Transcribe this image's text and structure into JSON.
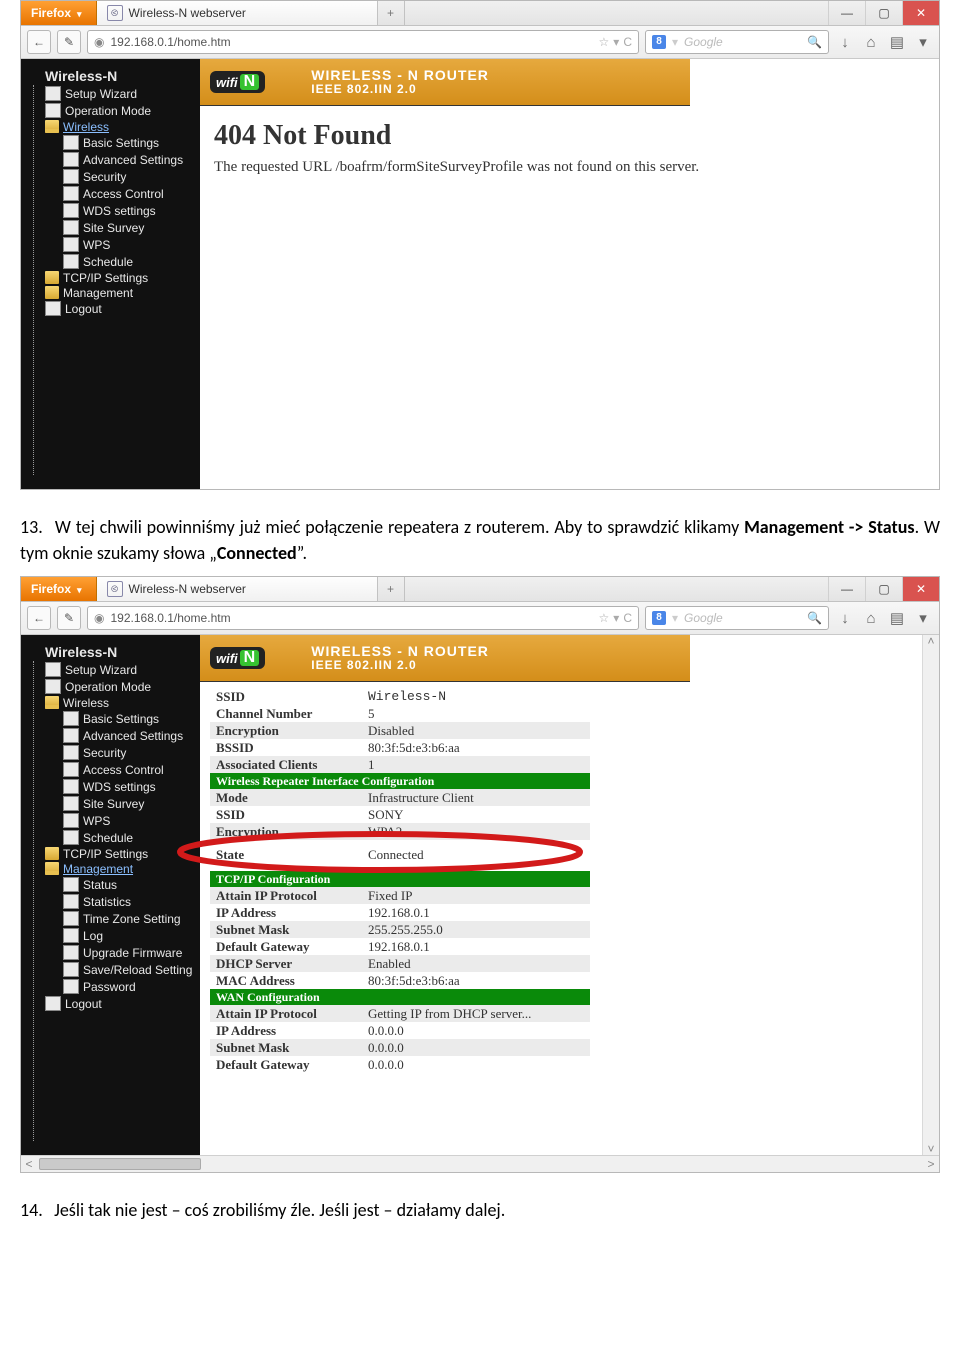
{
  "doc": {
    "para13_num": "13.",
    "para13_a": "W tej chwili powinniśmy już mieć połączenie repeatera z routerem. Aby to sprawdzić klikamy ",
    "para13_b1": "Management -> Status",
    "para13_c": ". W tym oknie szukamy słowa „",
    "para13_b2": "Connected",
    "para13_d": "”.",
    "para14_num": "14.",
    "para14_text": "Jeśli tak nie jest – coś zrobiliśmy źle. Jeśli jest – działamy dalej."
  },
  "browser": {
    "firefox_label": "Firefox",
    "tab_title": "Wireless-N webserver",
    "new_tab": "+",
    "win_min": "—",
    "win_max": "▢",
    "win_close": "✕",
    "back": "←",
    "tool_wand": "✎",
    "url_globe": "◉",
    "url": "192.168.0.1/home.htm",
    "star": "☆",
    "dd": "▾",
    "reload": "C",
    "search_g": "8",
    "search_sep": "▾",
    "search_ph": "Google",
    "search_go": "🔍",
    "dl": "↓",
    "home": "⌂",
    "menu": "▤",
    "menu_dd": "▾",
    "scroll_up": "˄",
    "scroll_down": "˅",
    "scroll_left": "<",
    "scroll_right": ">"
  },
  "router_banner": {
    "wifi_text": "wifi",
    "n_badge": "N",
    "line1": "WIRELESS - N ROUTER",
    "line2": "IEEE 802.IIN 2.0"
  },
  "sidebar1": {
    "head": "Wireless-N",
    "items": [
      {
        "lvl": 1,
        "ic": "doc",
        "label": "Setup Wizard"
      },
      {
        "lvl": 1,
        "ic": "doc",
        "label": "Operation Mode"
      },
      {
        "lvl": 1,
        "ic": "folder-open",
        "label": "Wireless",
        "hl": true
      },
      {
        "lvl": 2,
        "ic": "doc",
        "label": "Basic Settings"
      },
      {
        "lvl": 2,
        "ic": "doc",
        "label": "Advanced Settings"
      },
      {
        "lvl": 2,
        "ic": "doc",
        "label": "Security"
      },
      {
        "lvl": 2,
        "ic": "doc",
        "label": "Access Control"
      },
      {
        "lvl": 2,
        "ic": "doc",
        "label": "WDS settings"
      },
      {
        "lvl": 2,
        "ic": "doc",
        "label": "Site Survey"
      },
      {
        "lvl": 2,
        "ic": "doc",
        "label": "WPS"
      },
      {
        "lvl": 2,
        "ic": "doc",
        "label": "Schedule"
      },
      {
        "lvl": 1,
        "ic": "folder",
        "label": "TCP/IP Settings"
      },
      {
        "lvl": 1,
        "ic": "folder",
        "label": "Management"
      },
      {
        "lvl": 1,
        "ic": "doc",
        "label": "Logout"
      }
    ]
  },
  "error": {
    "h1": "404 Not Found",
    "msg": "The requested URL /boafrm/formSiteSurveyProfile was not found on this server."
  },
  "sidebar2": {
    "head": "Wireless-N",
    "items": [
      {
        "lvl": 1,
        "ic": "doc",
        "label": "Setup Wizard"
      },
      {
        "lvl": 1,
        "ic": "doc",
        "label": "Operation Mode"
      },
      {
        "lvl": 1,
        "ic": "folder-open",
        "label": "Wireless"
      },
      {
        "lvl": 2,
        "ic": "doc",
        "label": "Basic Settings"
      },
      {
        "lvl": 2,
        "ic": "doc",
        "label": "Advanced Settings"
      },
      {
        "lvl": 2,
        "ic": "doc",
        "label": "Security"
      },
      {
        "lvl": 2,
        "ic": "doc",
        "label": "Access Control"
      },
      {
        "lvl": 2,
        "ic": "doc",
        "label": "WDS settings"
      },
      {
        "lvl": 2,
        "ic": "doc",
        "label": "Site Survey"
      },
      {
        "lvl": 2,
        "ic": "doc",
        "label": "WPS"
      },
      {
        "lvl": 2,
        "ic": "doc",
        "label": "Schedule"
      },
      {
        "lvl": 1,
        "ic": "folder",
        "label": "TCP/IP Settings"
      },
      {
        "lvl": 1,
        "ic": "folder-open",
        "label": "Management",
        "hl": true
      },
      {
        "lvl": 2,
        "ic": "doc",
        "label": "Status"
      },
      {
        "lvl": 2,
        "ic": "doc",
        "label": "Statistics"
      },
      {
        "lvl": 2,
        "ic": "doc",
        "label": "Time Zone Setting"
      },
      {
        "lvl": 2,
        "ic": "doc",
        "label": "Log"
      },
      {
        "lvl": 2,
        "ic": "doc",
        "label": "Upgrade Firmware"
      },
      {
        "lvl": 2,
        "ic": "doc",
        "label": "Save/Reload Setting"
      },
      {
        "lvl": 2,
        "ic": "doc",
        "label": "Password"
      },
      {
        "lvl": 1,
        "ic": "doc",
        "label": "Logout"
      }
    ]
  },
  "status": {
    "rows_top": [
      {
        "k": "SSID",
        "v": "Wireless-N",
        "mono": true,
        "alt": false
      },
      {
        "k": "Channel Number",
        "v": "5",
        "alt": false
      },
      {
        "k": "Encryption",
        "v": "Disabled",
        "alt": true
      },
      {
        "k": "BSSID",
        "v": "80:3f:5d:e3:b6:aa",
        "alt": false
      },
      {
        "k": "Associated Clients",
        "v": "1",
        "alt": true
      }
    ],
    "sec_repeater": "Wireless Repeater Interface Configuration",
    "rows_repeater": [
      {
        "k": "Mode",
        "v": "Infrastructure Client",
        "alt": true
      },
      {
        "k": "SSID",
        "v": "SONY",
        "alt": false
      },
      {
        "k": "Encryption",
        "v": "WPA2",
        "alt": true
      }
    ],
    "state_k": "State",
    "state_v": "Connected",
    "sec_tcpip": "TCP/IP Configuration",
    "rows_tcpip": [
      {
        "k": "Attain IP Protocol",
        "v": "Fixed IP",
        "alt": true
      },
      {
        "k": "IP Address",
        "v": "192.168.0.1",
        "alt": false
      },
      {
        "k": "Subnet Mask",
        "v": "255.255.255.0",
        "alt": true
      },
      {
        "k": "Default Gateway",
        "v": "192.168.0.1",
        "alt": false
      },
      {
        "k": "DHCP Server",
        "v": "Enabled",
        "alt": true
      },
      {
        "k": "MAC Address",
        "v": "80:3f:5d:e3:b6:aa",
        "alt": false
      }
    ],
    "sec_wan": "WAN Configuration",
    "rows_wan": [
      {
        "k": "Attain IP Protocol",
        "v": "Getting IP from DHCP server...",
        "alt": true
      },
      {
        "k": "IP Address",
        "v": "0.0.0.0",
        "alt": false
      },
      {
        "k": "Subnet Mask",
        "v": "0.0.0.0",
        "alt": true
      },
      {
        "k": "Default Gateway",
        "v": "0.0.0.0",
        "alt": false
      }
    ]
  }
}
